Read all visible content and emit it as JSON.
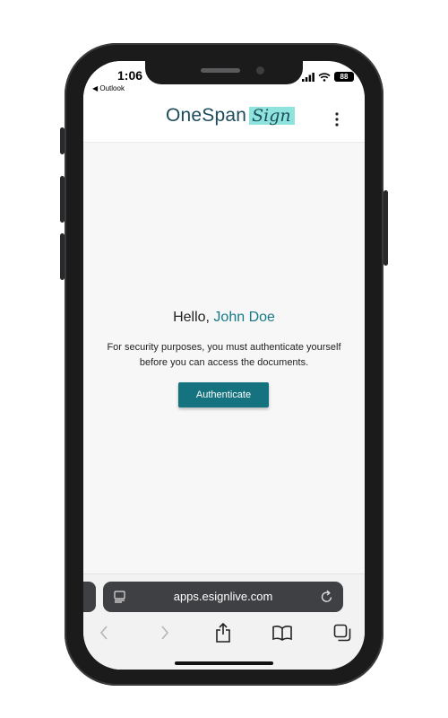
{
  "status_bar": {
    "time": "1:06",
    "back_app": "◀ Outlook",
    "battery": "88"
  },
  "header": {
    "logo_main": "OneSpan",
    "logo_sign": "Sign",
    "menu_icon": "more-vertical-icon"
  },
  "main": {
    "greeting_prefix": "Hello,",
    "user_name": "John Doe",
    "message_line1": "For security purposes, you must authenticate yourself",
    "message_line2": "before you can access the documents.",
    "button_label": "Authenticate"
  },
  "browser": {
    "url": "apps.esignlive.com",
    "toolbar_icons": [
      "back-chevron-icon",
      "forward-chevron-icon",
      "share-icon",
      "bookmarks-icon",
      "tabs-icon"
    ]
  },
  "colors": {
    "brand_teal": "#14737e",
    "logo_navy": "#1c4b5c",
    "logo_highlight": "#8fe3dd",
    "name_teal": "#157a87"
  }
}
